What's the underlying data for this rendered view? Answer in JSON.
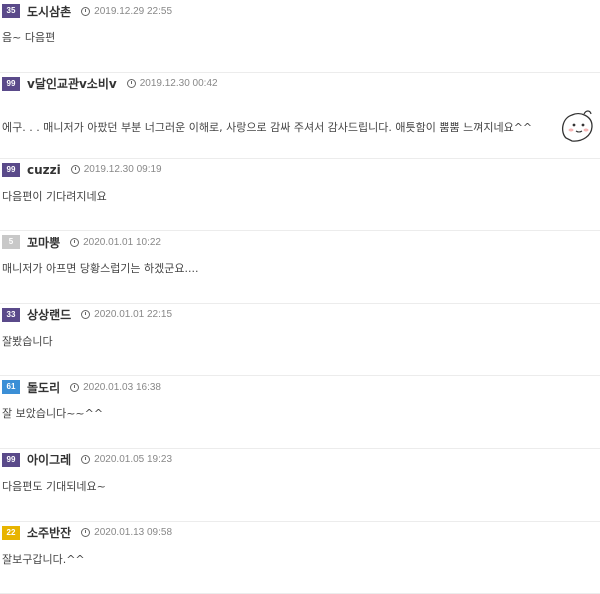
{
  "comments": [
    {
      "level": "35",
      "level_color": "#5a4a8a",
      "nickname": "도시삼촌",
      "date": "2019.12.29 22:55",
      "text": "음~ 다음편"
    },
    {
      "level": "99",
      "level_color": "#5a4a8a",
      "nickname": "v달인교관v소비v",
      "date": "2019.12.30 00:42",
      "text": "에구. . . 매니저가 아팠던 부분 너그러운 이해로, 사랑으로 감싸 주셔서 감사드립니다. 애틋함이 뿜뿜 느껴지네요^^"
    },
    {
      "level": "99",
      "level_color": "#5a4a8a",
      "nickname": "cuzzi",
      "date": "2019.12.30 09:19",
      "text": "다음편이 기다려지네요"
    },
    {
      "level": "5",
      "level_color": "#c8c8c8",
      "nickname": "꼬마뿡",
      "date": "2020.01.01 10:22",
      "text": "매니저가 아프면 당황스럽기는 하겠군요...."
    },
    {
      "level": "33",
      "level_color": "#5a4a8a",
      "nickname": "상상랜드",
      "date": "2020.01.01 22:15",
      "text": "잘봤습니다"
    },
    {
      "level": "61",
      "level_color": "#3b8fd6",
      "nickname": "돌도리",
      "date": "2020.01.03 16:38",
      "text": "잘 보았습니다~~^^"
    },
    {
      "level": "99",
      "level_color": "#5a4a8a",
      "nickname": "아이그레",
      "date": "2020.01.05 19:23",
      "text": "다음편도 기대되네요~"
    },
    {
      "level": "22",
      "level_color": "#e8b400",
      "nickname": "소주반잔",
      "date": "2020.01.13 09:58",
      "text": "잘보구갑니다.^^"
    }
  ]
}
